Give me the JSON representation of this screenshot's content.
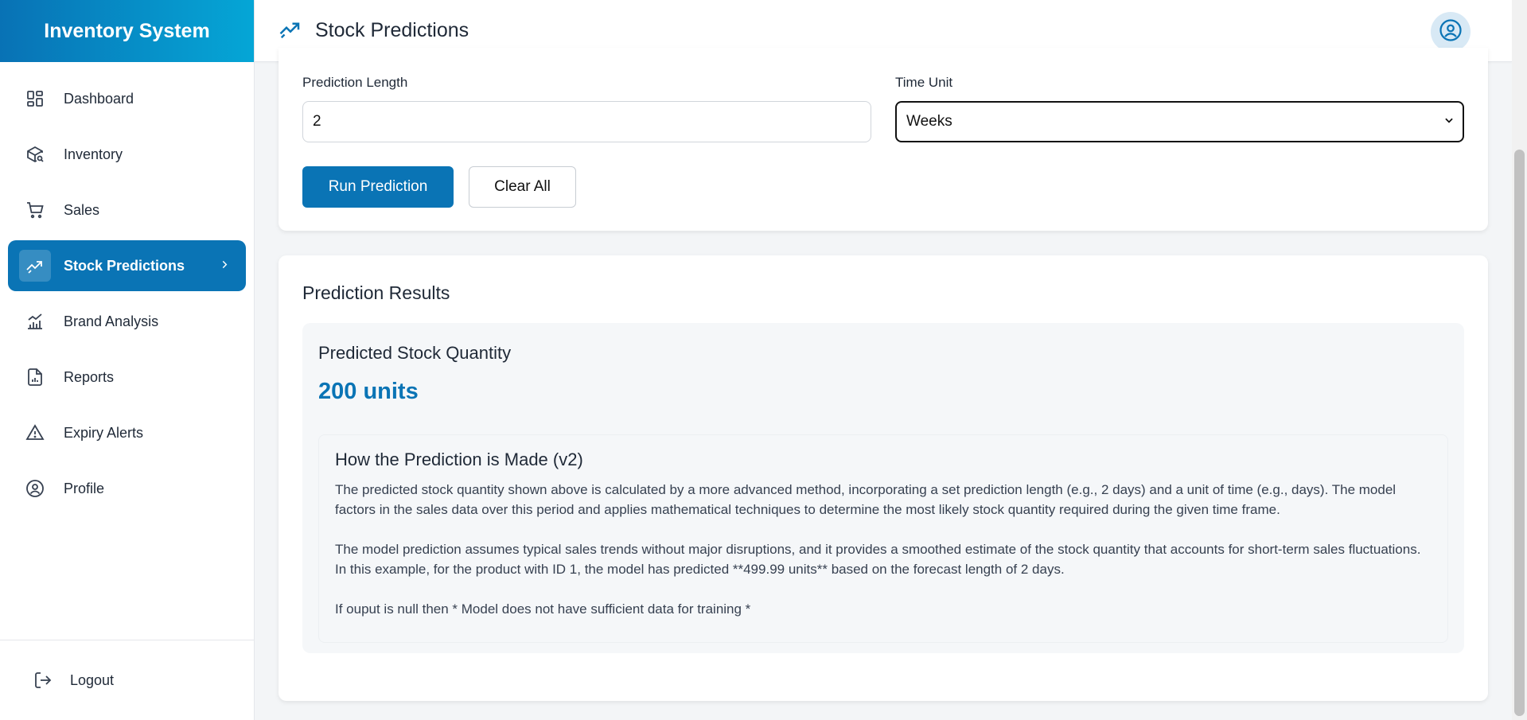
{
  "sidebar": {
    "brand": "Inventory System",
    "items": [
      {
        "label": "Dashboard",
        "icon": "dashboard-grid-icon"
      },
      {
        "label": "Inventory",
        "icon": "package-search-icon"
      },
      {
        "label": "Sales",
        "icon": "shopping-cart-icon"
      },
      {
        "label": "Stock Predictions",
        "icon": "trending-icon",
        "active": true
      },
      {
        "label": "Brand Analysis",
        "icon": "bar-chart-icon"
      },
      {
        "label": "Reports",
        "icon": "report-file-icon"
      },
      {
        "label": "Expiry Alerts",
        "icon": "warning-triangle-icon"
      },
      {
        "label": "Profile",
        "icon": "user-circle-icon"
      }
    ],
    "logout": "Logout"
  },
  "header": {
    "title": "Stock Predictions",
    "icon": "trending-icon",
    "avatar_icon": "user-circle-icon"
  },
  "form": {
    "length_label": "Prediction Length",
    "length_value": "2",
    "unit_label": "Time Unit",
    "unit_value": "Weeks",
    "run_label": "Run Prediction",
    "clear_label": "Clear All"
  },
  "results": {
    "title": "Prediction Results",
    "quantity_label": "Predicted Stock Quantity",
    "quantity_value": "200 units",
    "explain_title": "How the Prediction is Made (v2)",
    "para1": "The predicted stock quantity shown above is calculated by a more advanced method, incorporating a set prediction length (e.g., 2 days) and a unit of time (e.g., days). The model factors in the sales data over this period and applies mathematical techniques to determine the most likely stock quantity required during the given time frame.",
    "para2": "The model prediction assumes typical sales trends without major disruptions, and it provides a smoothed estimate of the stock quantity that accounts for short-term sales fluctuations. In this example, for the product with ID 1, the model has predicted **499.99 units** based on the forecast length of 2 days.",
    "para3": "If ouput is null then * Model does not have sufficient data for training *"
  },
  "colors": {
    "accent": "#0a74b5",
    "brand_gradient_start": "#0872b5",
    "brand_gradient_end": "#05a6d6"
  }
}
